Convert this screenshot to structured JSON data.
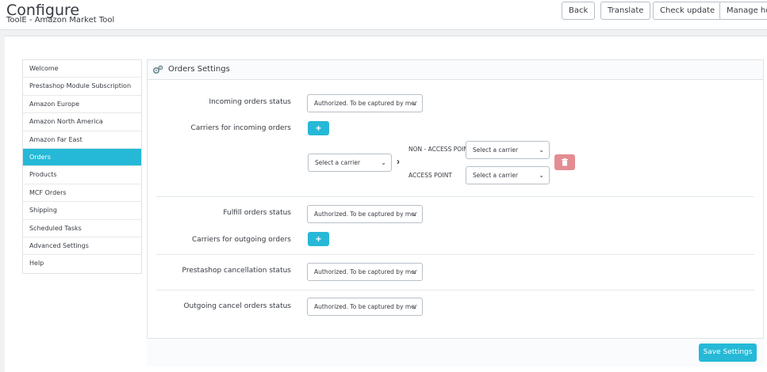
{
  "header": {
    "title": "Configure",
    "subtitle": "ToolE - Amazon Market Tool",
    "buttons": {
      "back": "Back",
      "translate": "Translate",
      "check_update": "Check update",
      "manage_hooks": "Manage hooks"
    }
  },
  "sidebar": {
    "items": [
      {
        "label": "Welcome"
      },
      {
        "label": "Prestashop Module Subscription"
      },
      {
        "label": "Amazon Europe"
      },
      {
        "label": "Amazon North America"
      },
      {
        "label": "Amazon Far East"
      },
      {
        "label": "Orders"
      },
      {
        "label": "Products"
      },
      {
        "label": "MCF Orders"
      },
      {
        "label": "Shipping"
      },
      {
        "label": "Scheduled Tasks"
      },
      {
        "label": "Advanced Settings"
      },
      {
        "label": "Help"
      }
    ],
    "active": "Orders"
  },
  "panel": {
    "title": "Orders Settings",
    "incoming_status_label": "Incoming orders status",
    "incoming_status_value": "Authorized. To be captured by mer",
    "carriers_incoming_label": "Carriers for incoming orders",
    "carrier_select": "Select a carrier",
    "non_access_point_label": "NON - ACCESS POINT",
    "non_access_point_value": "Select a carrier",
    "access_point_label": "ACCESS POINT",
    "access_point_value": "Select a carrier",
    "fulfill_status_label": "Fulfill orders status",
    "fulfill_status_value": "Authorized. To be captured by mer",
    "carriers_outgoing_label": "Carriers for outgoing orders",
    "cancellation_label": "Prestashop cancellation status",
    "cancellation_value": "Authorized. To be captured by mer",
    "outgoing_cancel_label": "Outgoing cancel orders status",
    "outgoing_cancel_value": "Authorized. To be captured by mer",
    "save_label": "Save Settings"
  },
  "colors": {
    "accent": "#25b9d7",
    "danger": "#e38d93"
  }
}
